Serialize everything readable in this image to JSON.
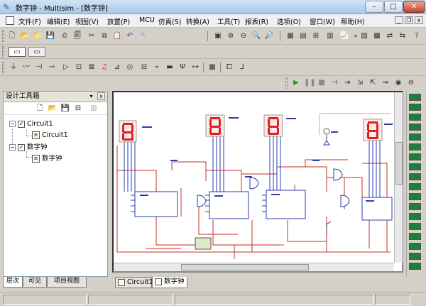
{
  "window": {
    "title": "数字钟 - Multisim - [数字钟]"
  },
  "menu": {
    "items": [
      "文件(F)",
      "编辑(E)",
      "视图(V)",
      "放置(P)",
      "MCU",
      "仿真(S)",
      "转换(A)",
      "工具(T)",
      "报表(R)",
      "选项(O)",
      "窗口(W)",
      "帮助(H)"
    ]
  },
  "panel": {
    "title": "设计工具箱",
    "tree": [
      {
        "label": "Circuit1",
        "level": 0
      },
      {
        "label": "Circuit1",
        "level": 1
      },
      {
        "label": "数字钟",
        "level": 0
      },
      {
        "label": "数字钟",
        "level": 1
      }
    ],
    "tabs": [
      "层次",
      "可见",
      "项目视图"
    ]
  },
  "canvas": {
    "tabs": [
      "Circuit1",
      "数字钟"
    ]
  },
  "colors": {
    "titlebar": "#cfe3f6",
    "wire": "#c0302a",
    "display": "#e02020",
    "accent": "#2a3db0",
    "sim_green": "#1f9a2f"
  }
}
